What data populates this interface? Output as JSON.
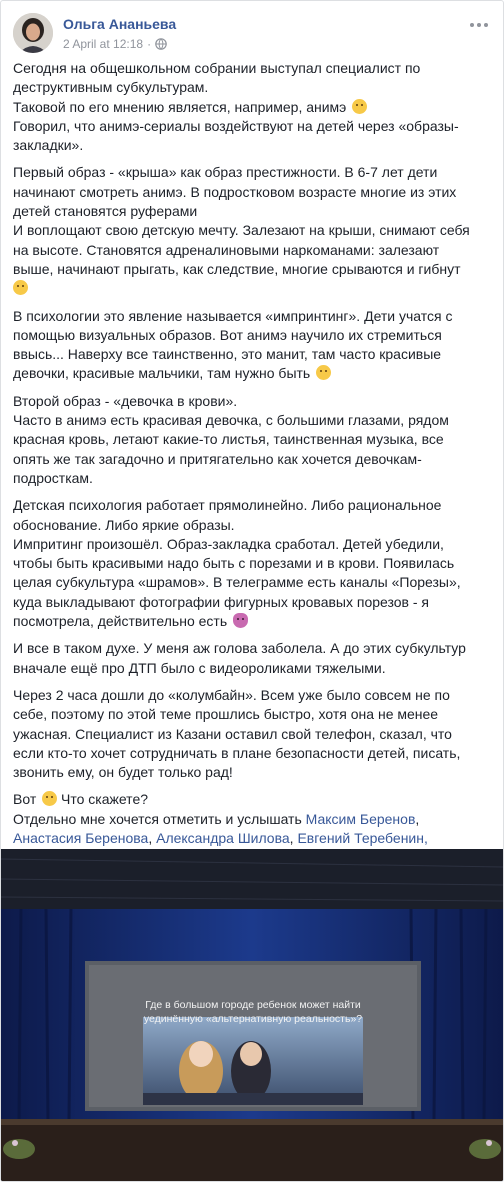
{
  "post": {
    "author": "Ольга Ананьева",
    "date": "2 April at 12:18",
    "separator": "·",
    "privacy_icon": "globe-icon",
    "more_icon": "more-options-icon"
  },
  "text": {
    "p1_l1": "Сегодня на общешкольном собрании выступал специалист по",
    "p1_l2": "деструктивным субкультурам.",
    "p1_l3": "Таковой по его мнению является, например, анимэ",
    "p1_l4": "Говорил, что анимэ-сериалы воздействуют на детей через «образы-",
    "p1_l5": "закладки».",
    "p2_l1": "Первый образ - «крыша» как образ престижности. В 6-7 лет дети",
    "p2_l2": "начинают смотреть анимэ. В подростковом возрасте многие из этих",
    "p2_l3": "детей становятся руферами",
    "p2_l4": "И воплощают свою детскую мечту. Залезают на крыши, снимают себя",
    "p2_l5": "на высоте. Становятся адреналиновыми наркоманами: залезают",
    "p2_l6": "выше, начинают прыгать, как следствие, многие срываются и гибнут",
    "p3_l1": "В психологии это явление называется «импринтинг». Дети учатся с",
    "p3_l2": "помощью визуальных образов. Вот анимэ научило их стремиться",
    "p3_l3": "ввысь... Наверху все таинственно, это манит, там часто красивые",
    "p3_l4": "девочки, красивые мальчики, там нужно быть",
    "p4_l1": "Второй образ - «девочка в крови».",
    "p4_l2": "Часто в анимэ есть красивая девочка, с большими глазами, рядом",
    "p4_l3": "красная кровь, летают какие-то листья, таинственная музыка, все",
    "p4_l4": "опять же так загадочно и притягательно как хочется девочкам-",
    "p4_l5": "подросткам.",
    "p5_l1": "Детская психология работает прямолинейно. Либо рациональное",
    "p5_l2": "обоснование. Либо яркие образы.",
    "p5_l3": "Импритинг произошёл. Образ-закладка сработал. Детей убедили,",
    "p5_l4": "чтобы быть красивыми надо быть с порезами и в крови. Появилась",
    "p5_l5": "целая субкультура «шрамов». В телеграмме есть каналы «Порезы»,",
    "p5_l6": "куда выкладывают фотографии фигурных кровавых порезов - я",
    "p5_l7": "посмотрела, действительно есть",
    "p6_l1": "И все в таком духе. У меня аж голова заболела. А до этих субкультур",
    "p6_l2": "вначале ещё про ДТП было с видеороликами тяжелыми.",
    "p7_l1": "Через 2 часа дошли до «колумбайн». Всем уже было совсем не по",
    "p7_l2": "себе, поэтому по этой теме прошлись быстро, хотя она не менее",
    "p7_l3": "ужасная. Специалист из Казани оставил свой телефон, сказал, что",
    "p7_l4": "если кто-то хочет сотрудничать в плане безопасности детей, писать,",
    "p7_l5": "звонить ему, он будет только рад!",
    "p8_vot": "Вот",
    "p8_q": "Что скажете?",
    "p8_l2": "Отдельно мне хочется отметить и услышать",
    "sep": ",",
    "tags": [
      "Максим Беренов",
      "Анастасия Беренова",
      "Александра Шилова",
      "Евгений Теребенин"
    ]
  },
  "emojis": {
    "e1": "face-with-rolling-eyes-icon",
    "e2": "sad-face-icon",
    "e3": "thinking-face-icon",
    "e4": "woman-shrugging-icon",
    "e5": "face-with-rolling-eyes-icon"
  },
  "photo": {
    "slide_l1": "Где в большом городе ребенок может найти",
    "slide_l2": "уединённую «альтернативную реальность»?"
  },
  "colors": {
    "link": "#385898",
    "meta": "#90949c",
    "text": "#1d2129",
    "curtain": "#1c3a8c"
  }
}
